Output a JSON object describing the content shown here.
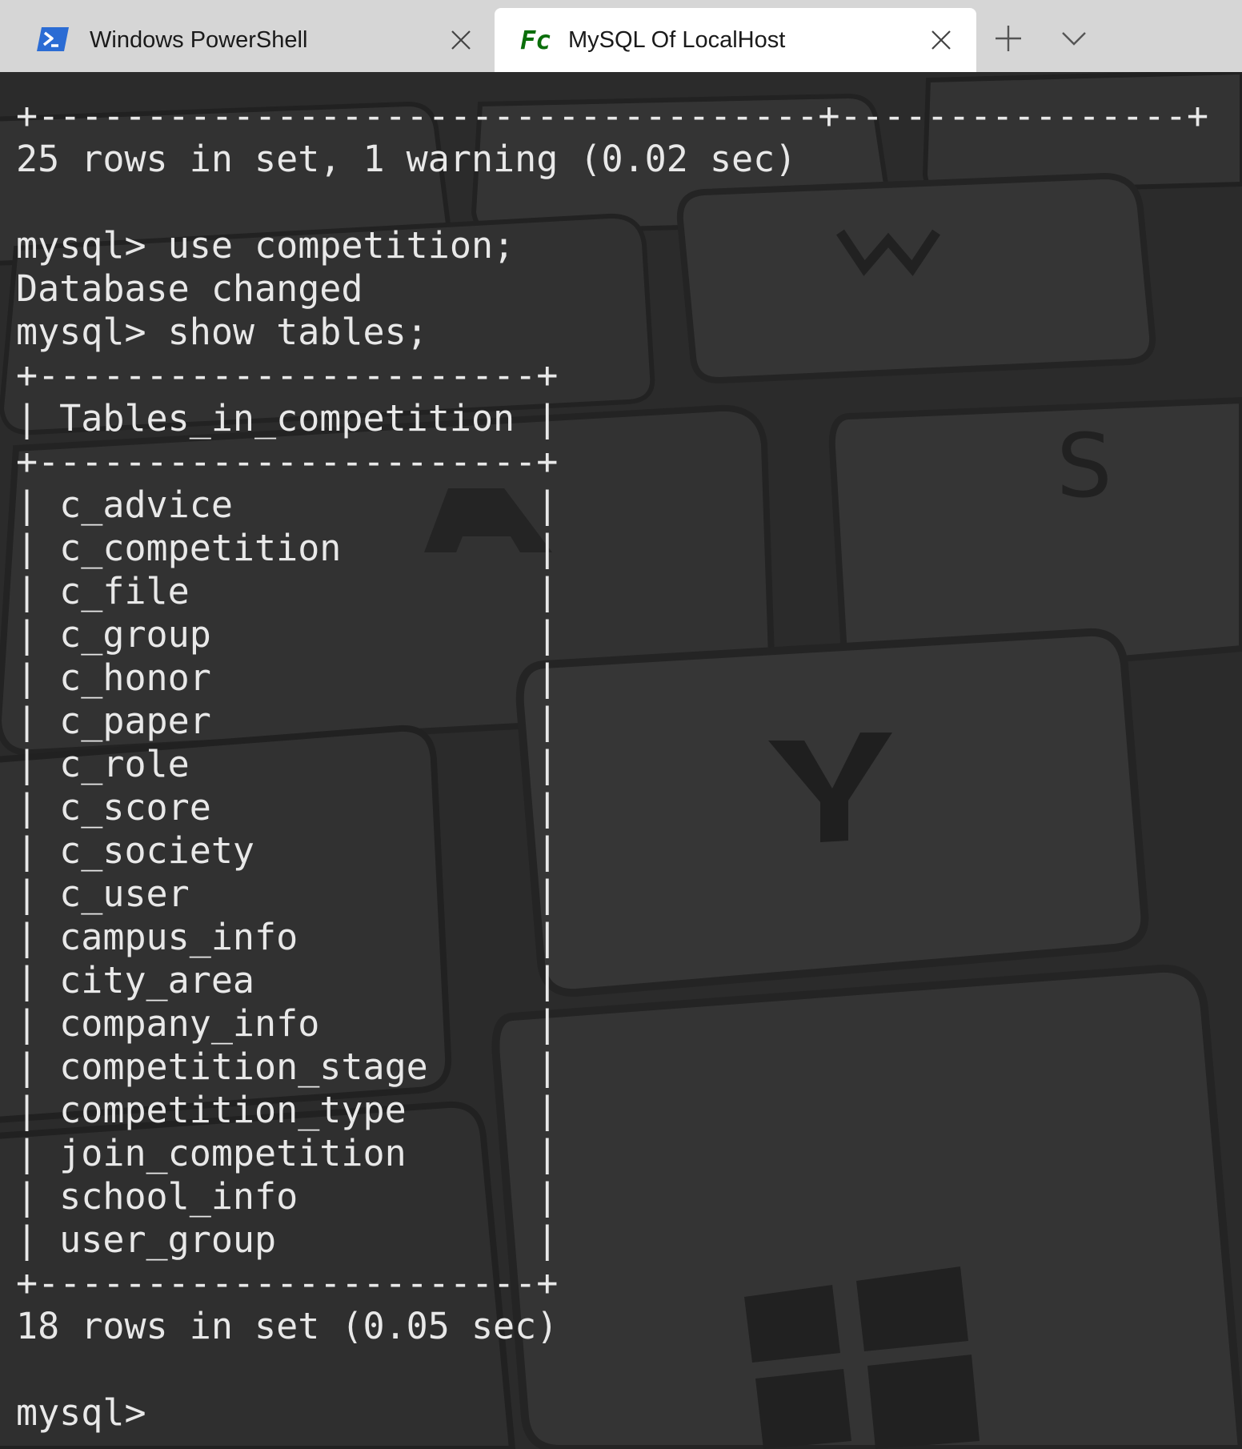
{
  "tabs": [
    {
      "title": "Windows PowerShell",
      "icon": "powershell-icon",
      "active": false
    },
    {
      "title": "MySQL Of LocalHost",
      "icon": "fc-icon",
      "icon_text": "Fc",
      "active": true
    }
  ],
  "colors": {
    "tabbar_bg": "#d6d6d6",
    "active_tab_bg": "#ffffff",
    "terminal_bg": "#333333",
    "terminal_text": "#e8e8e8",
    "fc_icon_color": "#0a6e0a",
    "powershell_icon_color": "#2b6cd4"
  },
  "terminal": {
    "lines": [
      "+------------------------------------+----------------+",
      "25 rows in set, 1 warning (0.02 sec)",
      "",
      "mysql> use competition;",
      "Database changed",
      "mysql> show tables;",
      "+-----------------------+",
      "| Tables_in_competition |",
      "+-----------------------+",
      "| c_advice              |",
      "| c_competition         |",
      "| c_file                |",
      "| c_group               |",
      "| c_honor               |",
      "| c_paper               |",
      "| c_role                |",
      "| c_score               |",
      "| c_society             |",
      "| c_user                |",
      "| campus_info           |",
      "| city_area             |",
      "| company_info          |",
      "| competition_stage     |",
      "| competition_type      |",
      "| join_competition      |",
      "| school_info           |",
      "| user_group            |",
      "+-----------------------+",
      "18 rows in set (0.05 sec)",
      "",
      "mysql> "
    ]
  }
}
